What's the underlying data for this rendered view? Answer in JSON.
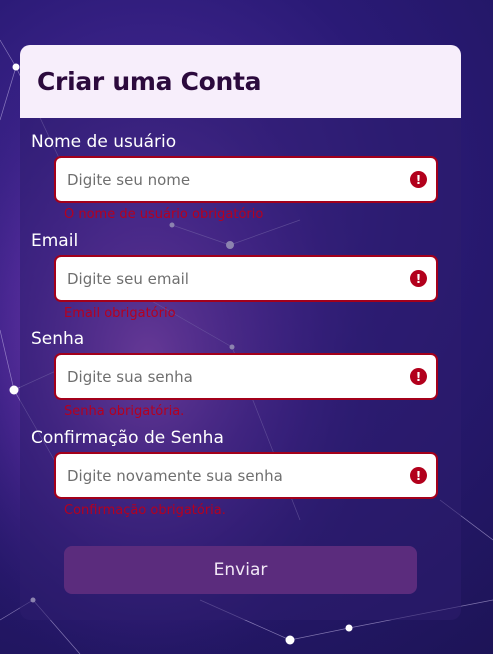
{
  "form": {
    "title": "Criar uma Conta",
    "fields": [
      {
        "label": "Nome de usuário",
        "placeholder": "Digite seu nome",
        "value": "",
        "error": "O nome de usuário obrigatório"
      },
      {
        "label": "Email",
        "placeholder": "Digite seu email",
        "value": "",
        "error": "Email obrigatório"
      },
      {
        "label": "Senha",
        "placeholder": "Digite sua senha",
        "value": "",
        "error": "Senha obrigatória."
      },
      {
        "label": "Confirmação de Senha",
        "placeholder": "Digite novamente sua senha",
        "value": "",
        "error": "Confirmação obrigatória."
      }
    ],
    "error_icon": "!",
    "submit_label": "Enviar"
  },
  "colors": {
    "header_bg": "#f7eefb",
    "title": "#2c0a3d",
    "error": "#b5001f",
    "button_bg": "#5b2c7d"
  }
}
